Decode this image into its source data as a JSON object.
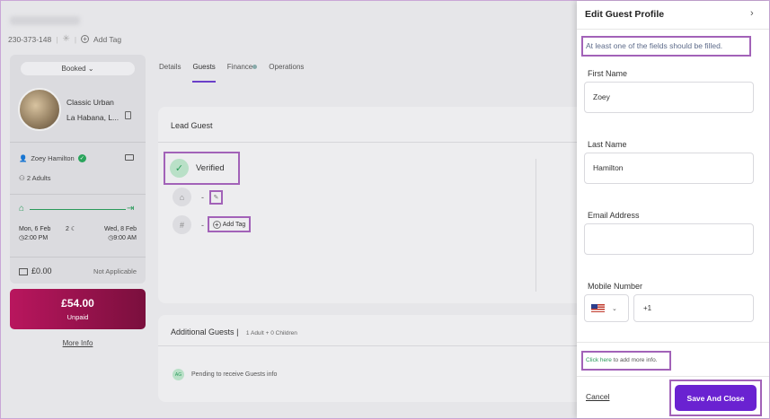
{
  "topbar": {
    "booking_id": "230-373-148",
    "add_tag": "Add Tag"
  },
  "summary": {
    "status": "Booked",
    "hotel_name_line1": "Classic Urban",
    "hotel_name_line2": "La Habana, L...",
    "guest_name": "Zoey Hamilton",
    "adults": "2 Adults",
    "checkin_date": "Mon, 6 Feb",
    "checkin_time": "2:00 PM",
    "nights": "2",
    "checkout_date": "Wed, 8 Feb",
    "checkout_time": "9:00 AM",
    "price": "£0.00",
    "price_status": "Not Applicable",
    "balance_amount": "£54.00",
    "balance_label": "Unpaid",
    "more_info": "More Info"
  },
  "tabs": [
    "Details",
    "Guests",
    "Finance",
    "Operations"
  ],
  "lead_guest": {
    "title": "Lead Guest",
    "verified": "Verified",
    "dash1": "-",
    "dash2": "-",
    "add_tag": "Add Tag"
  },
  "additional_guests": {
    "title": "Additional Guests",
    "summary": "1 Adult + 0 Children",
    "badge": "AG",
    "pending": "Pending to receive Guests info"
  },
  "panel": {
    "title": "Edit Guest Profile",
    "close": "›",
    "warning": "At least one of the fields should be filled.",
    "first_name_label": "First Name",
    "first_name_value": "Zoey",
    "last_name_label": "Last Name",
    "last_name_value": "Hamilton",
    "email_label": "Email Address",
    "email_value": "",
    "mobile_label": "Mobile Number",
    "country_code": "+1",
    "click_here": "Click here",
    "more_info_text": " to add more info.",
    "cancel": "Cancel",
    "save": "Save And Close"
  },
  "colors": {
    "accent": "#6a22d1",
    "unpaid": "#b9165e",
    "verified": "#2a9a5a",
    "highlight": "#a262b8"
  }
}
